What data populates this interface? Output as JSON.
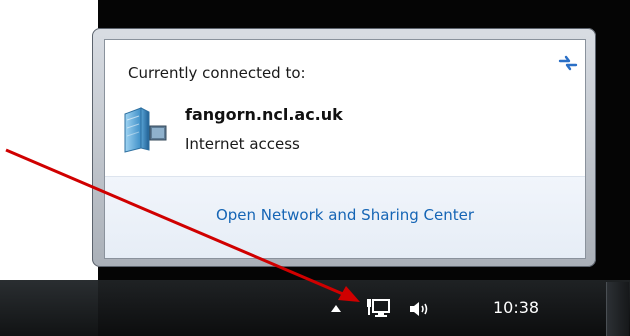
{
  "flyout": {
    "heading": "Currently connected to:",
    "network": {
      "name": "fangorn.ncl.ac.uk",
      "status": "Internet access"
    },
    "link": "Open Network and Sharing Center"
  },
  "taskbar": {
    "clock": "10:38"
  },
  "icons": {
    "refresh": "refresh-icon",
    "network_type": "server-network-icon",
    "tray_arrow": "show-hidden-icons-arrow",
    "tray_network": "network-icon",
    "tray_volume": "volume-icon"
  },
  "colors": {
    "link": "#1565b5",
    "annotation_arrow": "#d00000"
  }
}
